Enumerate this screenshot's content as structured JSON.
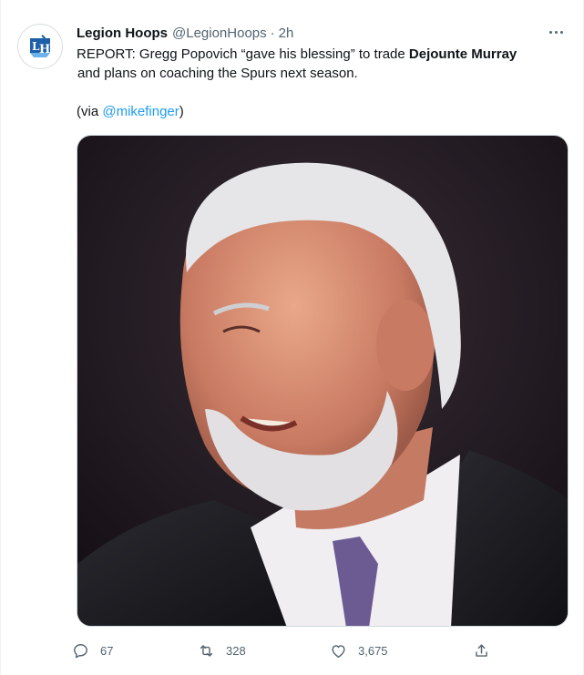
{
  "tweet": {
    "author_name": "Legion Hoops",
    "author_handle": "@LegionHoops",
    "separator": "·",
    "time": "2h",
    "text_line1_pre": "REPORT: Gregg Popovich “gave his blessing” to trade ",
    "text_line1_bold": "Dejounte Murray",
    "text_line2": "and plans on coaching the Spurs next season.",
    "via_pre": "(via ",
    "via_mention": "@mikefinger",
    "via_post": ")",
    "avatar_icon": "legion-hoops-logo",
    "more_icon": "more-dots-icon",
    "media_description_icon": "photo"
  },
  "actions": {
    "reply_count": "67",
    "retweet_count": "328",
    "like_count": "3,675",
    "reply_icon": "reply-icon",
    "retweet_icon": "retweet-icon",
    "like_icon": "heart-icon",
    "share_icon": "share-icon"
  },
  "colors": {
    "accent": "#1d9bf0",
    "muted": "#536471",
    "text": "#0f1419"
  }
}
